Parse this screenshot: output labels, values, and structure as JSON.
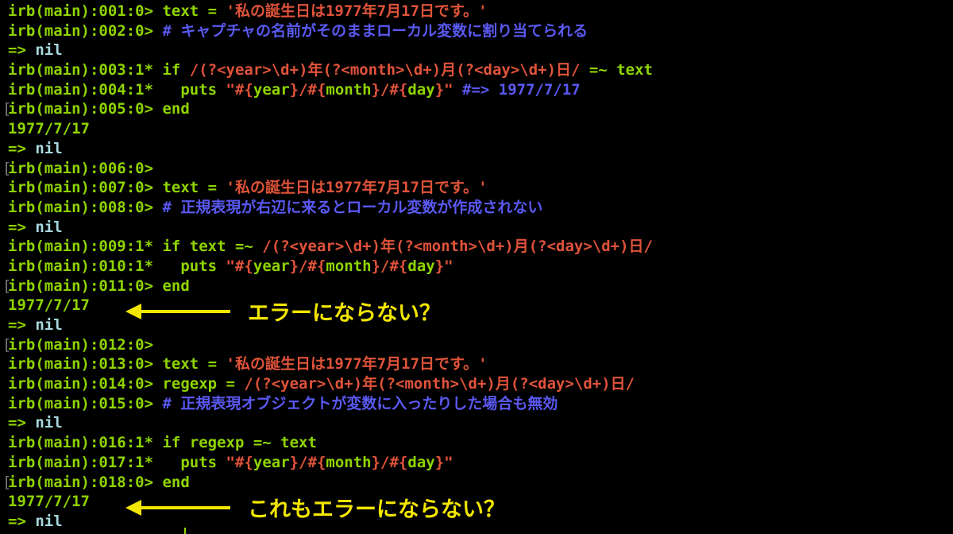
{
  "lines": [
    {
      "bar": false,
      "segments": [
        {
          "t": "irb(main):001:0> ",
          "c": "p"
        },
        {
          "t": "text = ",
          "c": "g"
        },
        {
          "t": "'私の誕生日は1977年7月17日です。'",
          "c": "s"
        }
      ]
    },
    {
      "bar": false,
      "segments": [
        {
          "t": "irb(main):002:0> ",
          "c": "p"
        },
        {
          "t": "# キャプチャの名前がそのままローカル変数に割り当てられる",
          "c": "c"
        }
      ]
    },
    {
      "bar": false,
      "segments": [
        {
          "t": "=> ",
          "c": "g"
        },
        {
          "t": "nil",
          "c": "w"
        }
      ]
    },
    {
      "bar": false,
      "segments": [
        {
          "t": "irb(main):003:1* ",
          "c": "p"
        },
        {
          "t": "if ",
          "c": "g"
        },
        {
          "t": "/(?<year>\\d+)年(?<month>\\d+)月(?<day>\\d+)日/",
          "c": "s"
        },
        {
          "t": " =~ text",
          "c": "g"
        }
      ]
    },
    {
      "bar": false,
      "segments": [
        {
          "t": "irb(main):004:1* ",
          "c": "p"
        },
        {
          "t": "  puts ",
          "c": "g"
        },
        {
          "t": "\"#{",
          "c": "s"
        },
        {
          "t": "year",
          "c": "g"
        },
        {
          "t": "}/#{",
          "c": "s"
        },
        {
          "t": "month",
          "c": "g"
        },
        {
          "t": "}/#{",
          "c": "s"
        },
        {
          "t": "day",
          "c": "g"
        },
        {
          "t": "}\"",
          "c": "s"
        },
        {
          "t": " #=> 1977/7/17",
          "c": "c"
        }
      ]
    },
    {
      "bar": true,
      "segments": [
        {
          "t": "irb(main):005:0> ",
          "c": "p"
        },
        {
          "t": "end",
          "c": "g"
        }
      ]
    },
    {
      "bar": false,
      "segments": [
        {
          "t": "1977/7/17",
          "c": "g"
        }
      ]
    },
    {
      "bar": false,
      "segments": [
        {
          "t": "=> ",
          "c": "g"
        },
        {
          "t": "nil",
          "c": "w"
        }
      ]
    },
    {
      "bar": true,
      "segments": [
        {
          "t": "irb(main):006:0>",
          "c": "p"
        }
      ]
    },
    {
      "bar": false,
      "segments": [
        {
          "t": "irb(main):007:0> ",
          "c": "p"
        },
        {
          "t": "text = ",
          "c": "g"
        },
        {
          "t": "'私の誕生日は1977年7月17日です。'",
          "c": "s"
        }
      ]
    },
    {
      "bar": false,
      "segments": [
        {
          "t": "irb(main):008:0> ",
          "c": "p"
        },
        {
          "t": "# 正規表現が右辺に来るとローカル変数が作成されない",
          "c": "c"
        }
      ]
    },
    {
      "bar": false,
      "segments": [
        {
          "t": "=> ",
          "c": "g"
        },
        {
          "t": "nil",
          "c": "w"
        }
      ]
    },
    {
      "bar": false,
      "segments": [
        {
          "t": "irb(main):009:1* ",
          "c": "p"
        },
        {
          "t": "if text =~ ",
          "c": "g"
        },
        {
          "t": "/(?<year>\\d+)年(?<month>\\d+)月(?<day>\\d+)日/",
          "c": "s"
        }
      ]
    },
    {
      "bar": false,
      "segments": [
        {
          "t": "irb(main):010:1* ",
          "c": "p"
        },
        {
          "t": "  puts ",
          "c": "g"
        },
        {
          "t": "\"#{",
          "c": "s"
        },
        {
          "t": "year",
          "c": "g"
        },
        {
          "t": "}/#{",
          "c": "s"
        },
        {
          "t": "month",
          "c": "g"
        },
        {
          "t": "}/#{",
          "c": "s"
        },
        {
          "t": "day",
          "c": "g"
        },
        {
          "t": "}\"",
          "c": "s"
        }
      ]
    },
    {
      "bar": true,
      "segments": [
        {
          "t": "irb(main):011:0> ",
          "c": "p"
        },
        {
          "t": "end",
          "c": "g"
        }
      ]
    },
    {
      "bar": false,
      "segments": [
        {
          "t": "1977/7/17",
          "c": "g"
        }
      ]
    },
    {
      "bar": false,
      "segments": [
        {
          "t": "=> ",
          "c": "g"
        },
        {
          "t": "nil",
          "c": "w"
        }
      ]
    },
    {
      "bar": true,
      "segments": [
        {
          "t": "irb(main):012:0>",
          "c": "p"
        }
      ]
    },
    {
      "bar": false,
      "segments": [
        {
          "t": "irb(main):013:0> ",
          "c": "p"
        },
        {
          "t": "text = ",
          "c": "g"
        },
        {
          "t": "'私の誕生日は1977年7月17日です。'",
          "c": "s"
        }
      ]
    },
    {
      "bar": false,
      "segments": [
        {
          "t": "irb(main):014:0> ",
          "c": "p"
        },
        {
          "t": "regexp = ",
          "c": "g"
        },
        {
          "t": "/(?<year>\\d+)年(?<month>\\d+)月(?<day>\\d+)日/",
          "c": "s"
        }
      ]
    },
    {
      "bar": false,
      "segments": [
        {
          "t": "irb(main):015:0> ",
          "c": "p"
        },
        {
          "t": "# 正規表現オブジェクトが変数に入ったりした場合も無効",
          "c": "c"
        }
      ]
    },
    {
      "bar": false,
      "segments": [
        {
          "t": "=> ",
          "c": "g"
        },
        {
          "t": "nil",
          "c": "w"
        }
      ]
    },
    {
      "bar": false,
      "segments": [
        {
          "t": "irb(main):016:1* ",
          "c": "p"
        },
        {
          "t": "if regexp =~ text",
          "c": "g"
        }
      ]
    },
    {
      "bar": false,
      "segments": [
        {
          "t": "irb(main):017:1* ",
          "c": "p"
        },
        {
          "t": "  puts ",
          "c": "g"
        },
        {
          "t": "\"#{",
          "c": "s"
        },
        {
          "t": "year",
          "c": "g"
        },
        {
          "t": "}/#{",
          "c": "s"
        },
        {
          "t": "month",
          "c": "g"
        },
        {
          "t": "}/#{",
          "c": "s"
        },
        {
          "t": "day",
          "c": "g"
        },
        {
          "t": "}\"",
          "c": "s"
        }
      ]
    },
    {
      "bar": true,
      "segments": [
        {
          "t": "irb(main):018:0> ",
          "c": "p"
        },
        {
          "t": "end",
          "c": "g"
        }
      ]
    },
    {
      "bar": false,
      "segments": [
        {
          "t": "1977/7/17",
          "c": "g"
        }
      ]
    },
    {
      "bar": false,
      "segments": [
        {
          "t": "=> ",
          "c": "g"
        },
        {
          "t": "nil",
          "c": "w"
        }
      ]
    }
  ],
  "annotations": {
    "first": "エラーにならない？",
    "second": "これもエラーにならない？"
  },
  "colors": {
    "background": "#000000",
    "prompt": "#8fd400",
    "string": "#e0533a",
    "comment": "#5a59f2",
    "nil": "#a7d8de",
    "annotation": "#f2e600"
  }
}
